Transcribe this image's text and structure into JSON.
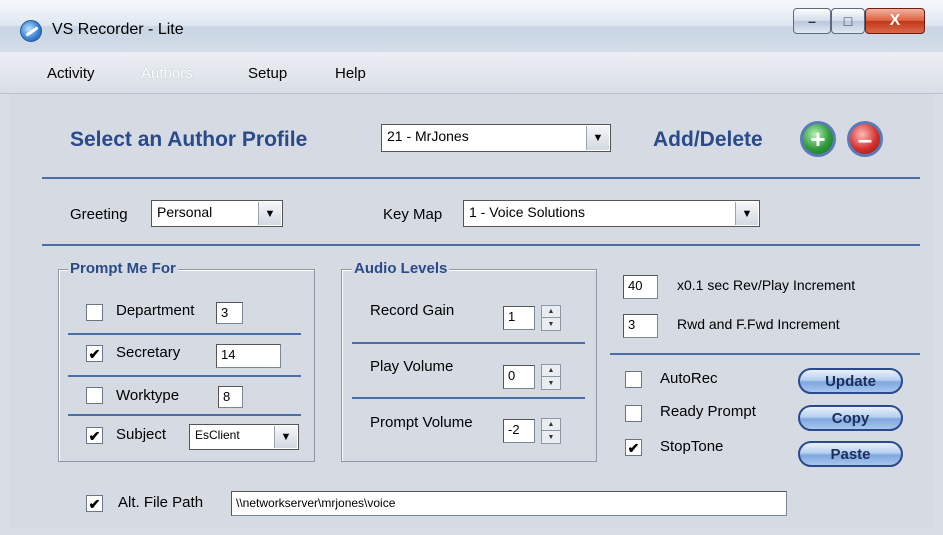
{
  "window": {
    "title": "VS Recorder - Lite",
    "minimize_glyph": "–",
    "maximize_glyph": "□",
    "close_glyph": "X"
  },
  "menu": [
    "Activity",
    "Authors",
    "Setup",
    "Help"
  ],
  "author": {
    "label": "Select an Author Profile",
    "selected": "21 - MrJones",
    "add_delete_label": "Add/Delete",
    "add_glyph": "+",
    "delete_glyph": "–"
  },
  "greeting": {
    "label": "Greeting",
    "value": "Personal"
  },
  "keymap": {
    "label": "Key Map",
    "value": "1 - Voice Solutions"
  },
  "prompt_me_for": {
    "title": "Prompt Me For",
    "items": [
      {
        "label": "Department",
        "checked": false,
        "value": "3"
      },
      {
        "label": "Secretary",
        "checked": true,
        "value": "14"
      },
      {
        "label": "Worktype",
        "checked": false,
        "value": "8"
      },
      {
        "label": "Subject",
        "checked": true,
        "value": "EsClient"
      }
    ]
  },
  "audio_levels": {
    "title": "Audio Levels",
    "items": [
      {
        "label": "Record Gain",
        "value": "1"
      },
      {
        "label": "Play Volume",
        "value": "0"
      },
      {
        "label": "Prompt Volume",
        "value": "-2"
      }
    ]
  },
  "increments": [
    {
      "value": "40",
      "label": "x0.1 sec Rev/Play Increment"
    },
    {
      "value": "3",
      "label": "Rwd and F.Fwd Increment"
    }
  ],
  "options": [
    {
      "label": "AutoRec",
      "checked": false
    },
    {
      "label": "Ready Prompt",
      "checked": false
    },
    {
      "label": "StopTone",
      "checked": true
    }
  ],
  "buttons": {
    "update": "Update",
    "copy": "Copy",
    "paste": "Paste"
  },
  "alt_path": {
    "label": "Alt. File Path",
    "checked": true,
    "value": "\\\\networkserver\\mrjones\\voice"
  },
  "check_glyph": "✔",
  "dropdown_glyph": "▼",
  "spin_up_glyph": "▲",
  "spin_down_glyph": "▼"
}
